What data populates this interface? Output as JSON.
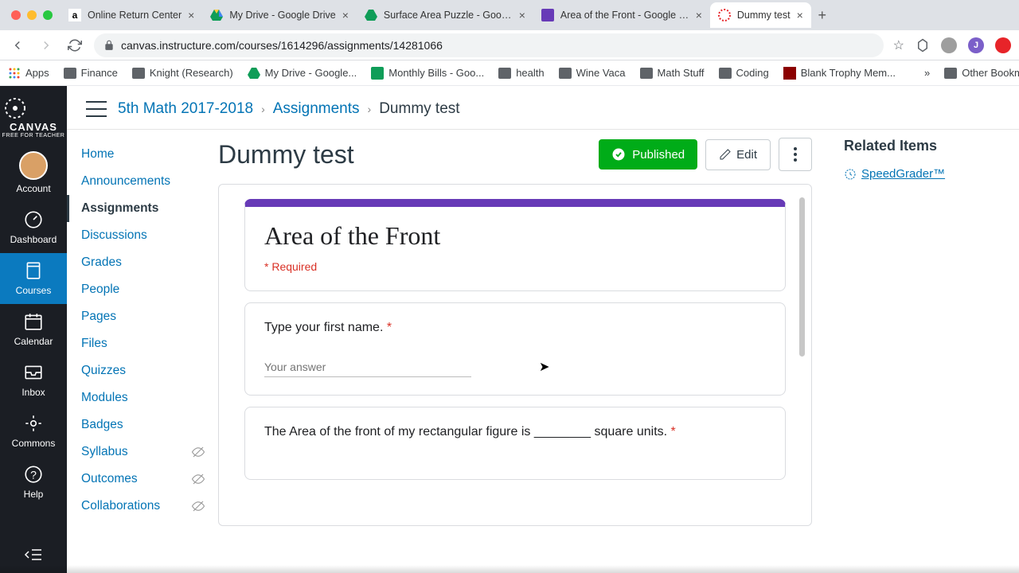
{
  "browser": {
    "tabs": [
      {
        "title": "Online Return Center",
        "favicon": "amazon"
      },
      {
        "title": "My Drive - Google Drive",
        "favicon": "drive"
      },
      {
        "title": "Surface Area Puzzle - Google...",
        "favicon": "drive"
      },
      {
        "title": "Area of the Front - Google Fo...",
        "favicon": "forms"
      },
      {
        "title": "Dummy test",
        "favicon": "canvas",
        "active": true
      }
    ],
    "url": "canvas.instructure.com/courses/1614296/assignments/14281066",
    "bookmarks": [
      "Apps",
      "Finance",
      "Knight (Research)",
      "My Drive - Google...",
      "Monthly Bills - Goo...",
      "health",
      "Wine Vaca",
      "Math Stuff",
      "Coding",
      "Blank Trophy Mem...",
      "Other Bookmarks"
    ]
  },
  "breadcrumbs": {
    "course": "5th Math 2017-2018",
    "section": "Assignments",
    "page": "Dummy test"
  },
  "global_nav": {
    "logo": "CANVAS",
    "logo_sub": "FREE FOR TEACHER",
    "items": [
      {
        "label": "Account",
        "icon": "avatar"
      },
      {
        "label": "Dashboard",
        "icon": "dash"
      },
      {
        "label": "Courses",
        "icon": "book",
        "active": true
      },
      {
        "label": "Calendar",
        "icon": "cal"
      },
      {
        "label": "Inbox",
        "icon": "inbox"
      },
      {
        "label": "Commons",
        "icon": "commons"
      },
      {
        "label": "Help",
        "icon": "help"
      }
    ]
  },
  "course_nav": [
    {
      "label": "Home"
    },
    {
      "label": "Announcements"
    },
    {
      "label": "Assignments",
      "active": true
    },
    {
      "label": "Discussions"
    },
    {
      "label": "Grades"
    },
    {
      "label": "People"
    },
    {
      "label": "Pages"
    },
    {
      "label": "Files"
    },
    {
      "label": "Quizzes"
    },
    {
      "label": "Modules"
    },
    {
      "label": "Badges"
    },
    {
      "label": "Syllabus",
      "hidden": true
    },
    {
      "label": "Outcomes",
      "hidden": true
    },
    {
      "label": "Collaborations",
      "hidden": true
    }
  ],
  "page": {
    "title": "Dummy test",
    "published": "Published",
    "edit": "Edit"
  },
  "form": {
    "title": "Area of the Front",
    "required": "* Required",
    "q1": "Type your first name.",
    "placeholder": "Your answer",
    "q2": "The Area of the front of my rectangular figure is ________ square units."
  },
  "related": {
    "title": "Related Items",
    "speedgrader": "SpeedGrader™"
  }
}
